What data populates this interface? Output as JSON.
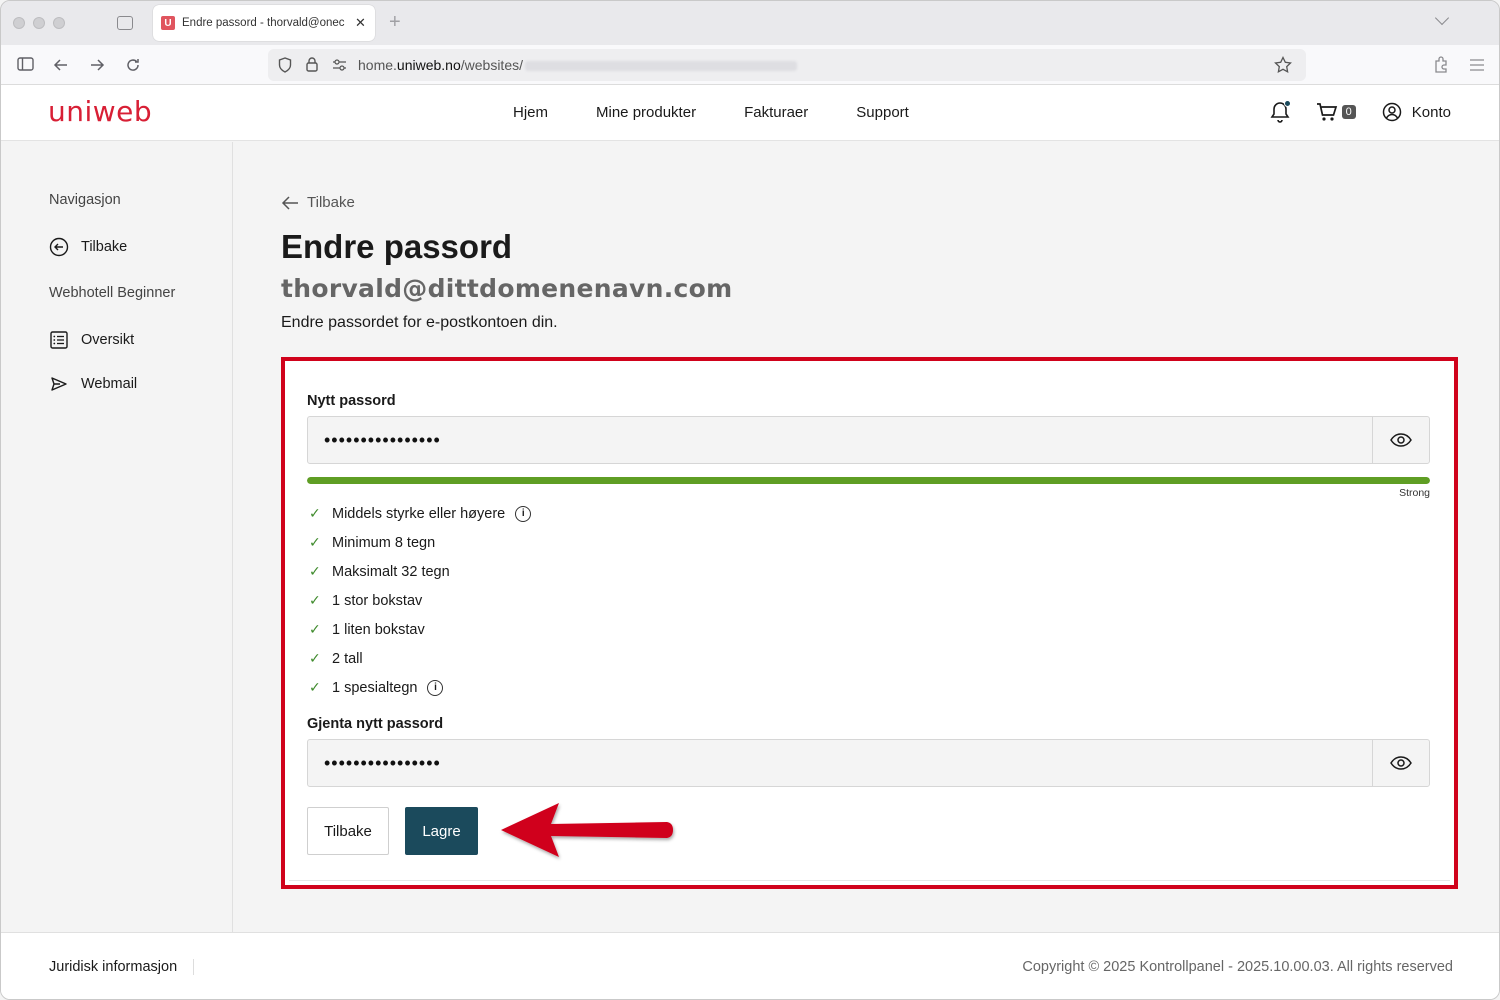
{
  "browser": {
    "tab_title": "Endre passord - thorvald@onec",
    "favicon_letter": "U",
    "url_prefix": "home.",
    "url_domain": "uniweb.no",
    "url_path": "/websites/"
  },
  "header": {
    "logo": "uniweb",
    "nav": [
      "Hjem",
      "Mine produkter",
      "Fakturaer",
      "Support"
    ],
    "cart_count": "0",
    "account_label": "Konto"
  },
  "sidebar": {
    "heading": "Navigasjon",
    "back_label": "Tilbake",
    "product_heading": "Webhotell Beginner",
    "items": [
      "Oversikt",
      "Webmail"
    ]
  },
  "main": {
    "back_link": "Tilbake",
    "title": "Endre passord",
    "email": "thorvald@dittdomenenavn.com",
    "description": "Endre passordet for e-postkontoen din."
  },
  "form": {
    "new_password_label": "Nytt passord",
    "new_password_value": "••••••••••••••••",
    "strength_label": "Strong",
    "strength_level": 1.0,
    "requirements": [
      "Middels styrke eller høyere",
      "Minimum 8 tegn",
      "Maksimalt 32 tegn",
      "1 stor bokstav",
      "1 liten bokstav",
      "2 tall",
      "1 spesialtegn"
    ],
    "repeat_password_label": "Gjenta nytt passord",
    "repeat_password_value": "••••••••••••••••",
    "back_button": "Tilbake",
    "save_button": "Lagre"
  },
  "footer": {
    "legal": "Juridisk informasjon",
    "copyright": "Copyright © 2025 Kontrollpanel - 2025.10.00.03. All rights reserved"
  },
  "colors": {
    "brand": "#d81f35",
    "primary_button": "#1b4a5c",
    "highlight": "#d0021b",
    "strength": "#5f9e24"
  }
}
